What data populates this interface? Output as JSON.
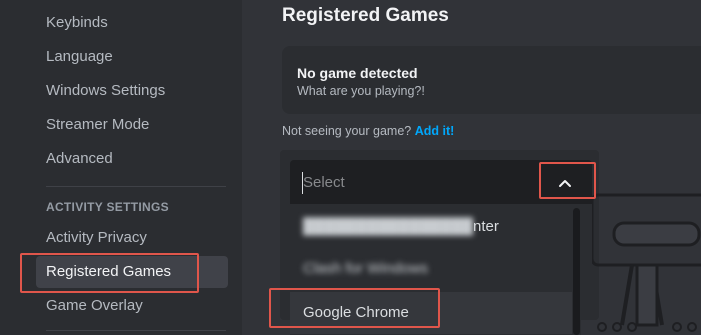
{
  "sidebar": {
    "items": [
      {
        "label": "Keybinds"
      },
      {
        "label": "Language"
      },
      {
        "label": "Windows Settings"
      },
      {
        "label": "Streamer Mode"
      },
      {
        "label": "Advanced"
      }
    ],
    "activity_section": {
      "header": "ACTIVITY SETTINGS",
      "items": [
        {
          "label": "Activity Privacy"
        },
        {
          "label": "Registered Games",
          "active": true
        },
        {
          "label": "Game Overlay"
        }
      ]
    }
  },
  "main": {
    "title": "Registered Games",
    "detect_card": {
      "title": "No game detected",
      "subtitle": "What are you playing?!"
    },
    "not_seeing_text": "Not seeing your game?",
    "add_link": "Add it!",
    "select": {
      "placeholder": "Select",
      "expanded": true,
      "options": [
        {
          "label": "nter",
          "obscured": true
        },
        {
          "label": "Clash for Windows",
          "obscured": true
        },
        {
          "label": "Google Chrome",
          "hovered": true
        }
      ]
    }
  },
  "colors": {
    "accent_link": "#00a8fc",
    "highlight_box": "#e0564b",
    "sidebar_bg": "#2b2d31",
    "main_bg": "#313338"
  }
}
